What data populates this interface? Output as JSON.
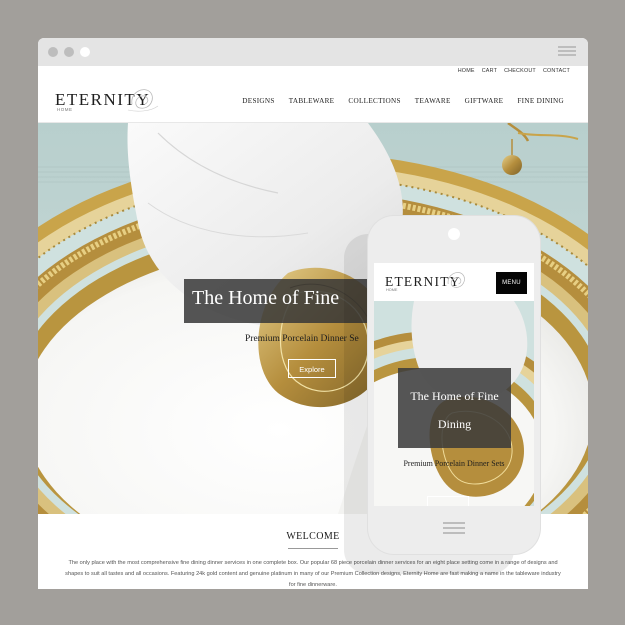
{
  "desktop": {
    "utility_links": [
      "HOME",
      "CART",
      "CHECKOUT",
      "CONTACT"
    ],
    "logo": "ETERNITY",
    "logo_sub": "HOME",
    "nav": [
      "DESIGNS",
      "TABLEWARE",
      "COLLECTIONS",
      "TEAWARE",
      "GIFTWARE",
      "FINE DINING"
    ],
    "hero": {
      "title": "The Home of Fine",
      "subtitle": "Premium Porcelain Dinner Se",
      "button": "Explore"
    },
    "welcome": {
      "heading": "WELCOME",
      "body": "The only place with the most comprehensive fine dining dinner services in one complete box. Our popular 68 piece porcelain dinner services for an eight place setting come in a range of designs and shapes to suit all tastes and all occasions. Featuring 24k gold content and genuine platinum in many of our Premium Collection designs, Eternity Home are fast making a name in the tableware industry for fine dinnerware."
    }
  },
  "mobile": {
    "logo": "ETERNITY",
    "logo_sub": "HOME",
    "menu_label": "MENU",
    "hero_title": "The Home of Fine Dining",
    "hero_subtitle": "Premium Porcelain Dinner Sets"
  },
  "colors": {
    "background": "#a29f9b",
    "window_dots": [
      "#bdbdbd",
      "#bdbdbd",
      "#ffffff"
    ],
    "gold": "#c9a44a",
    "plate_band": "#cfe1df"
  },
  "icons": [
    "window-dot-icon",
    "hamburger-icon",
    "logo-swirl-icon",
    "camera-icon",
    "home-button-icon"
  ]
}
